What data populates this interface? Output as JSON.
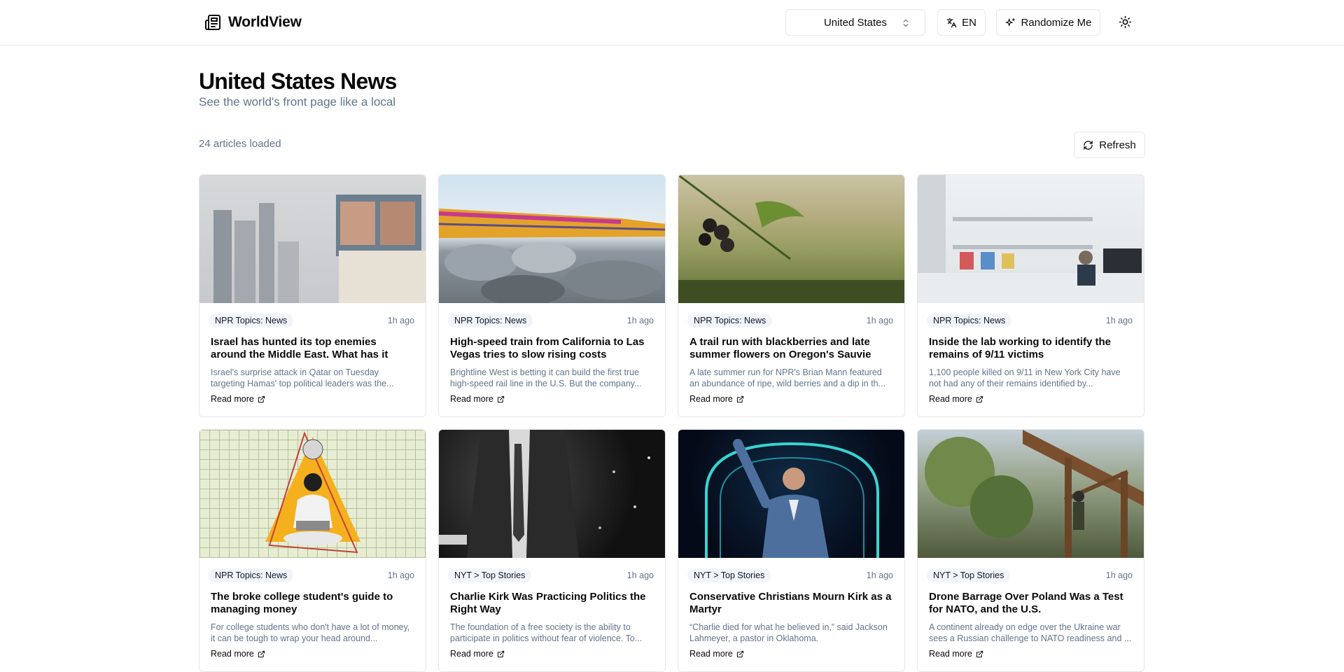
{
  "app": {
    "name": "WorldView"
  },
  "header": {
    "country": "United States",
    "language": "EN",
    "randomize_label": "Randomize Me"
  },
  "page": {
    "title": "United States News",
    "subtitle": "See the world's front page like a local",
    "count_text": "24 articles loaded",
    "refresh_label": "Refresh"
  },
  "articles": [
    {
      "source": "NPR Topics: News",
      "time": "1h ago",
      "title": "Israel has hunted its top enemies around the Middle East. What has it achieved?",
      "description": "Israel's surprise attack in Qatar on Tuesday targeting Hamas' top political leaders was the...",
      "read_more": "Read more"
    },
    {
      "source": "NPR Topics: News",
      "time": "1h ago",
      "title": "High-speed train from California to Las Vegas tries to slow rising costs",
      "description": "Brightline West is betting it can build the first true high-speed rail line in the U.S. But the company...",
      "read_more": "Read more"
    },
    {
      "source": "NPR Topics: News",
      "time": "1h ago",
      "title": "A trail run with blackberries and late summer flowers on Oregon's Sauvie Island",
      "description": "A late summer run for NPR's Brian Mann featured an abundance of ripe, wild berries and a dip in th...",
      "read_more": "Read more"
    },
    {
      "source": "NPR Topics: News",
      "time": "1h ago",
      "title": "Inside the lab working to identify the remains of 9/11 victims",
      "description": "1,100 people killed on 9/11 in New York City have not had any of their remains identified by...",
      "read_more": "Read more"
    },
    {
      "source": "NPR Topics: News",
      "time": "1h ago",
      "title": "The broke college student's guide to managing money",
      "description": "For college students who don't have a lot of money, it can be tough to wrap your head around...",
      "read_more": "Read more"
    },
    {
      "source": "NYT > Top Stories",
      "time": "1h ago",
      "title": "Charlie Kirk Was Practicing Politics the Right Way",
      "description": "The foundation of a free society is the ability to participate in politics without fear of violence. To...",
      "read_more": "Read more"
    },
    {
      "source": "NYT > Top Stories",
      "time": "1h ago",
      "title": "Conservative Christians Mourn Kirk as a Martyr",
      "description": "“Charlie died for what he believed in,” said Jackson Lahmeyer, a pastor in Oklahoma.",
      "read_more": "Read more"
    },
    {
      "source": "NYT > Top Stories",
      "time": "1h ago",
      "title": "Drone Barrage Over Poland Was a Test for NATO, and the U.S.",
      "description": "A continent already on edge over the Ukraine war sees a Russian challenge to NATO readiness and ...",
      "read_more": "Read more"
    }
  ],
  "icons": {
    "brand": "newspaper-icon",
    "country_select": "chevron-up-down-icon",
    "language": "translate-icon",
    "randomize": "sparkles-icon",
    "theme": "sun-icon",
    "refresh": "refresh-icon",
    "read_more": "external-link-icon"
  }
}
